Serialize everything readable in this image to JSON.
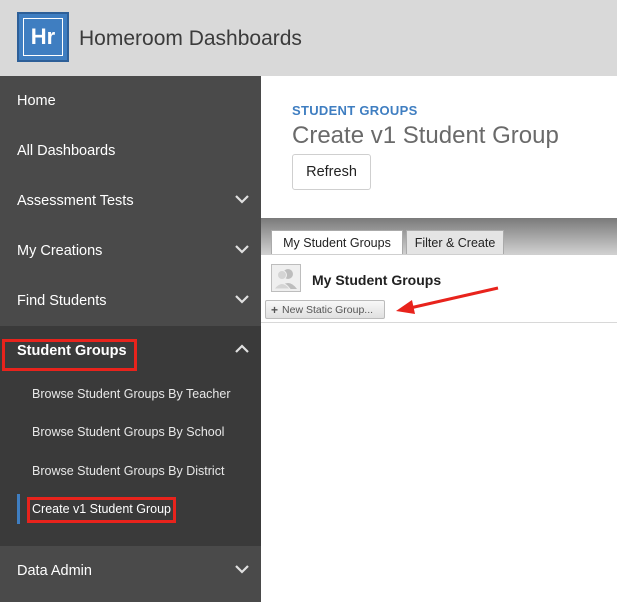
{
  "header": {
    "logo_text": "Hr",
    "app_title": "Homeroom Dashboards"
  },
  "sidebar": {
    "items": [
      {
        "label": "Home"
      },
      {
        "label": "All Dashboards"
      },
      {
        "label": "Assessment Tests"
      },
      {
        "label": "My Creations"
      },
      {
        "label": "Find Students"
      },
      {
        "label": "Student Groups"
      },
      {
        "label": "Data Admin"
      }
    ],
    "sub_items": [
      {
        "label": "Browse Student Groups By Teacher"
      },
      {
        "label": "Browse Student Groups By School"
      },
      {
        "label": "Browse Student Groups By District"
      },
      {
        "label": "Create v1 Student Group"
      }
    ]
  },
  "main": {
    "section_label": "STUDENT GROUPS",
    "page_title": "Create v1 Student Group",
    "refresh_label": "Refresh",
    "tabs": [
      {
        "label": "My Student Groups"
      },
      {
        "label": "Filter & Create"
      }
    ],
    "panel_title": "My Student Groups",
    "new_group_label": "New Static Group..."
  },
  "colors": {
    "accent": "#3f7ec1",
    "sidebar_bg": "#4a4a4a",
    "highlight": "#e8231c"
  }
}
